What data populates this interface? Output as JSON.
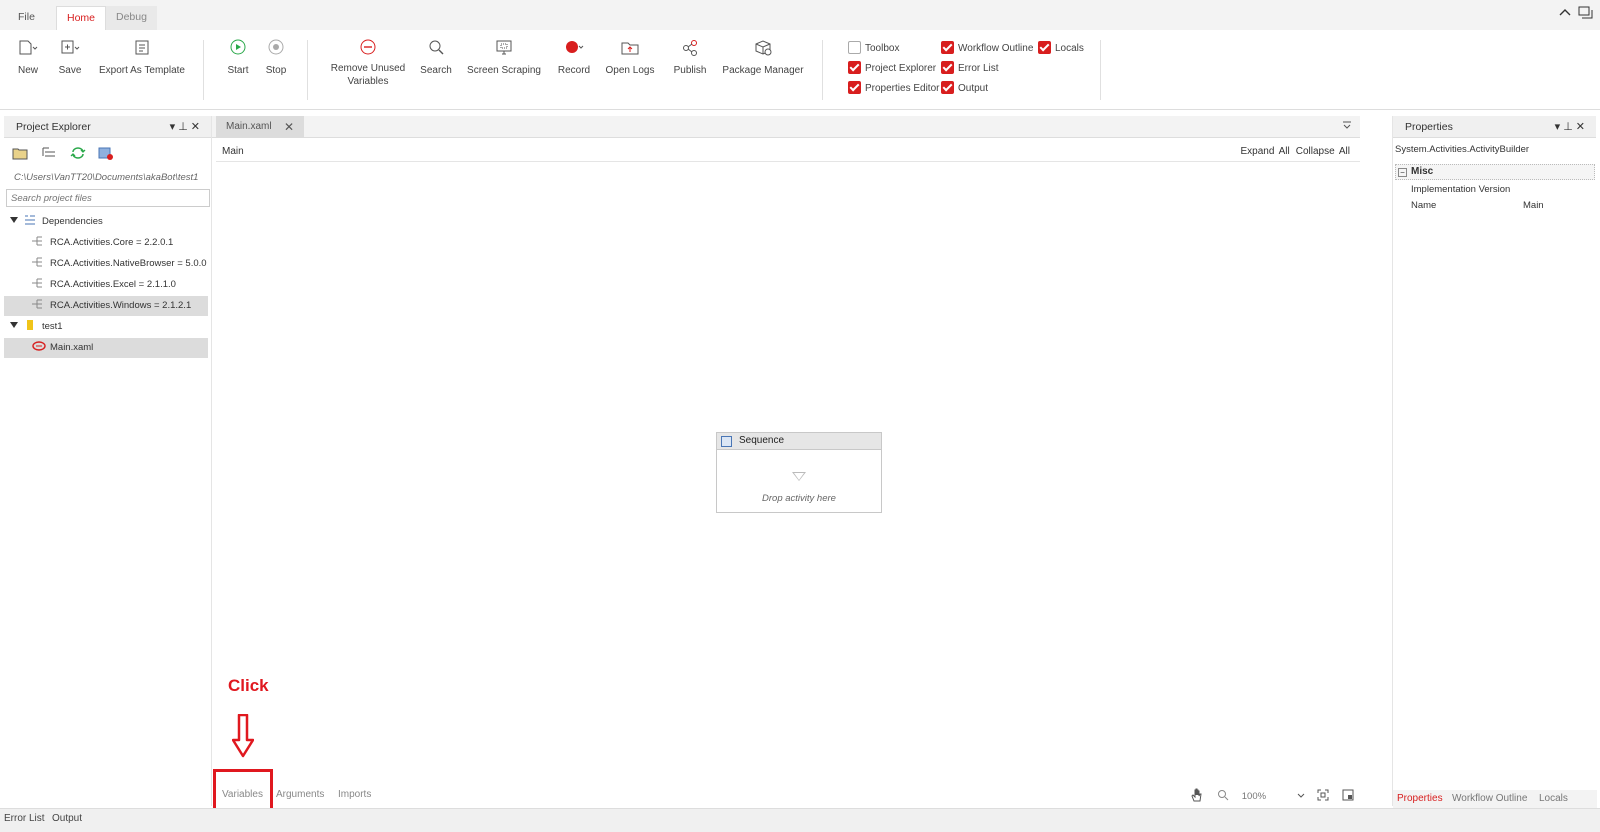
{
  "menu": {
    "tabs": [
      "File",
      "Home",
      "Debug"
    ],
    "active": "Home"
  },
  "ribbon": {
    "buttons": {
      "new": "New",
      "save": "Save",
      "export_template": "Export As Template",
      "start": "Start",
      "stop": "Stop",
      "remove_unused_1": "Remove Unused",
      "remove_unused_2": "Variables",
      "search": "Search",
      "screen_scraping": "Screen Scraping",
      "record": "Record",
      "open_logs": "Open Logs",
      "publish": "Publish",
      "package_manager": "Package Manager"
    },
    "checkboxes": [
      {
        "label": "Toolbox",
        "checked": false
      },
      {
        "label": "Project Explorer",
        "checked": true
      },
      {
        "label": "Properties Editor",
        "checked": true
      },
      {
        "label": "Workflow Outline",
        "checked": true
      },
      {
        "label": "Error List",
        "checked": true
      },
      {
        "label": "Output",
        "checked": true
      },
      {
        "label": "Locals",
        "checked": true
      }
    ]
  },
  "project_explorer": {
    "title": "Project Explorer",
    "path": "C:\\Users\\VanTT20\\Documents\\akaBot\\test1",
    "search_placeholder": "Search project files",
    "dependencies_label": "Dependencies",
    "dependencies": [
      "RCA.Activities.Core = 2.2.0.1",
      "RCA.Activities.NativeBrowser = 5.0.0",
      "RCA.Activities.Excel = 2.1.1.0",
      "RCA.Activities.Windows = 2.1.2.1"
    ],
    "project_folder": "test1",
    "main_file": "Main.xaml"
  },
  "designer": {
    "tab_label": "Main.xaml",
    "breadcrumb": "Main",
    "expand_all": "Expand All",
    "collapse_all": "Collapse All",
    "sequence_title": "Sequence",
    "drop_hint": "Drop activity here",
    "bottom_tabs": {
      "variables": "Variables",
      "arguments": "Arguments",
      "imports": "Imports"
    },
    "zoom": "100%"
  },
  "annotation": {
    "text": "Click",
    "color": "#e0181f"
  },
  "properties": {
    "title": "Properties",
    "type": "System.Activities.ActivityBuilder",
    "category": "Misc",
    "rows": [
      {
        "key": "Implementation Version",
        "value": ""
      },
      {
        "key": "Name",
        "value": "Main"
      }
    ],
    "bottom_tabs": [
      "Properties",
      "Workflow Outline",
      "Locals"
    ]
  },
  "status_tabs": [
    "Error List",
    "Output"
  ],
  "colors": {
    "accent": "#d81e1e"
  }
}
